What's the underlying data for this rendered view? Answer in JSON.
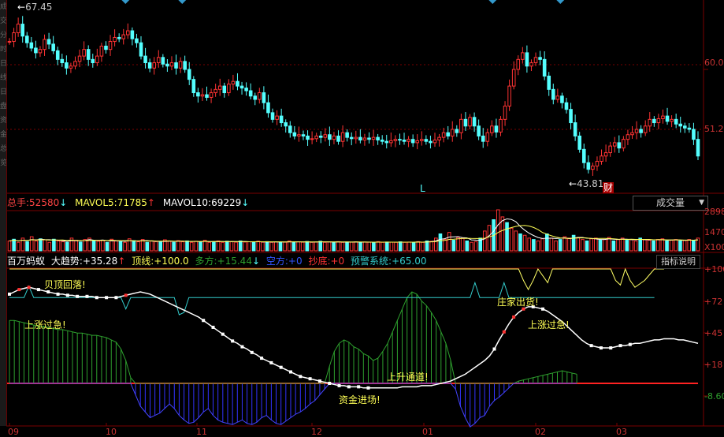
{
  "colors": {
    "up": "#ff3333",
    "down": "#54ffff",
    "grid": "#7a0000",
    "ma5": "#ffffff",
    "ma10": "#ffff55",
    "green": "#2ea02e",
    "blue": "#3333ff",
    "cyan": "#33cccc",
    "yellow": "#ffff66"
  },
  "price_panel": {
    "high_label": "67.45",
    "low_label": "43.81",
    "marker_L": "L",
    "marker_cai": "财",
    "axis": [
      "60.0",
      "51.2"
    ],
    "closes": [
      64.2,
      65.5,
      66.8,
      65.0,
      64.0,
      63.2,
      62.5,
      63.0,
      64.5,
      63.8,
      62.8,
      61.5,
      61.0,
      60.2,
      60.5,
      61.2,
      62.0,
      63.0,
      61.5,
      61.0,
      62.0,
      63.5,
      63.0,
      64.2,
      64.8,
      64.6,
      65.2,
      65.8,
      64.6,
      64.0,
      62.0,
      61.0,
      60.2,
      61.0,
      61.8,
      60.8,
      60.5,
      61.0,
      60.2,
      61.2,
      60.0,
      58.5,
      56.5,
      56.0,
      56.2,
      55.8,
      56.5,
      57.0,
      57.5,
      56.5,
      57.8,
      58.2,
      57.5,
      57.2,
      56.8,
      56.0,
      55.5,
      56.5,
      55.0,
      53.5,
      52.5,
      53.0,
      52.0,
      51.5,
      50.5,
      50.0,
      50.2,
      50.0,
      49.5,
      49.6,
      50.0,
      49.8,
      50.2,
      49.5,
      50.0,
      49.2,
      50.5,
      49.8,
      49.6,
      49.8,
      49.4,
      49.7,
      49.5,
      49.8,
      49.4,
      49.2,
      49.0,
      49.3,
      49.5,
      49.4,
      49.2,
      49.5,
      49.0,
      49.3,
      49.5,
      49.2,
      49.0,
      49.4,
      49.8,
      50.5,
      50.0,
      51.0,
      50.5,
      52.5,
      51.5,
      52.8,
      51.5,
      50.0,
      49.2,
      50.5,
      51.5,
      50.6,
      52.5,
      54.5,
      57.5,
      60.0,
      61.5,
      62.5,
      60.5,
      61.0,
      61.8,
      61.5,
      59.0,
      57.0,
      55.5,
      56.0,
      55.0,
      54.0,
      52.0,
      50.0,
      48.0,
      46.0,
      45.0,
      45.5,
      46.2,
      47.0,
      47.5,
      48.5,
      49.0,
      48.2,
      49.5,
      50.2,
      50.5,
      51.0,
      50.5,
      51.5,
      52.5,
      52.0,
      52.6,
      53.0,
      52.2,
      52.5,
      51.8,
      51.5,
      51.2,
      51.0,
      49.5,
      47.0
    ]
  },
  "volume_panel": {
    "title": "总手:",
    "total": "52580",
    "ma5_label": "MAVOL5:",
    "ma5": "71785",
    "ma10_label": "MAVOL10:",
    "ma10": "69229",
    "axis": [
      "2898",
      "1470",
      "X100"
    ],
    "dropdown": "成交量",
    "vols": [
      700,
      820,
      600,
      900,
      650,
      1000,
      700,
      850,
      780,
      600,
      820,
      700,
      650,
      600,
      900,
      750,
      620,
      800,
      900,
      700,
      680,
      750,
      600,
      820,
      700,
      650,
      600,
      850,
      720,
      640,
      800,
      600,
      700,
      650,
      620,
      780,
      690,
      600,
      720,
      640,
      700,
      600,
      680,
      620,
      750,
      600,
      640,
      700,
      600,
      680,
      650,
      610,
      700,
      620,
      640,
      600,
      680,
      610,
      650,
      600,
      640,
      620,
      610,
      700,
      600,
      640,
      610,
      660,
      600,
      620,
      680,
      600,
      640,
      610,
      650,
      600,
      620,
      610,
      640,
      600,
      620,
      610,
      600,
      650,
      600,
      620,
      610,
      600,
      640,
      600,
      620,
      610,
      650,
      600,
      700,
      680,
      900,
      1200,
      800,
      1300,
      750,
      950,
      880,
      700,
      600,
      650,
      900,
      1400,
      1800,
      2200,
      2898,
      2400,
      2000,
      1600,
      1400,
      1200,
      1100,
      900,
      800,
      700,
      850,
      1200,
      900,
      700,
      800,
      1000,
      900,
      1100,
      950,
      800,
      700,
      850,
      900,
      750,
      800,
      950,
      700,
      800,
      900,
      750,
      800,
      700,
      900,
      800,
      750,
      700,
      800,
      850,
      700,
      750,
      800,
      700,
      750,
      800,
      700,
      900
    ]
  },
  "indicator_panel": {
    "name": "百万蚂蚁",
    "trend_label": "大趋势:",
    "trend": "+35.28",
    "top_label": "顶线:",
    "top": "+100.0",
    "long_label": "多方:",
    "long": "+15.44",
    "short_label": "空方:",
    "short": "+0",
    "bottom_label": "抄底:",
    "bottom": "+0",
    "warn_label": "预警系统:",
    "warn": "+65.00",
    "button": "指标说明",
    "axis": [
      "+100",
      "+72",
      "+45",
      "+18",
      "-8.60"
    ],
    "annotations": [
      "贝顶回落!",
      "上涨过急!",
      "庄家出货!",
      "上涨过急!",
      "上升通道!",
      "资金进场!"
    ],
    "trend_vals": [
      78,
      80,
      82,
      83,
      84,
      83,
      82,
      81,
      80,
      79,
      78,
      78,
      77,
      77,
      76,
      76,
      76,
      76,
      75,
      75,
      75,
      75,
      75,
      76,
      77,
      78,
      79,
      80,
      79,
      78,
      76,
      74,
      72,
      70,
      68,
      66,
      64,
      62,
      60,
      58,
      55,
      52,
      49,
      46,
      43,
      40,
      37,
      35,
      32,
      30,
      27,
      25,
      22,
      20,
      18,
      16,
      14,
      12,
      10,
      8,
      6,
      5,
      4,
      3,
      2,
      1,
      0,
      -1,
      -2,
      -2,
      -3,
      -3,
      -3,
      -4,
      -4,
      -4,
      -4,
      -4,
      -4,
      -4,
      -4,
      -3,
      -3,
      -3,
      -3,
      -2,
      -2,
      -2,
      -1,
      0,
      1,
      2,
      4,
      6,
      8,
      11,
      14,
      17,
      20,
      24,
      30,
      38,
      45,
      52,
      58,
      62,
      65,
      67,
      67,
      66,
      65,
      63,
      60,
      57,
      54,
      50,
      46,
      42,
      38,
      35,
      33,
      32,
      31,
      31,
      31,
      32,
      33,
      33,
      34,
      35,
      35,
      36,
      37,
      38,
      38,
      39,
      39,
      39,
      38,
      38,
      37,
      36,
      35
    ],
    "green_vals": [
      55,
      55,
      54,
      53,
      52,
      51,
      50,
      50,
      49,
      48,
      47,
      47,
      46,
      45,
      44,
      44,
      43,
      42,
      42,
      41,
      40,
      38,
      36,
      30,
      20,
      5,
      -10,
      -20,
      -25,
      -30,
      -28,
      -26,
      -22,
      -18,
      -22,
      -28,
      -32,
      -35,
      -34,
      -30,
      -25,
      -22,
      -28,
      -32,
      -34,
      -35,
      -36,
      -34,
      -32,
      -35,
      -36,
      -34,
      -30,
      -28,
      -32,
      -35,
      -36,
      -33,
      -30,
      -27,
      -25,
      -22,
      -18,
      -15,
      -10,
      -5,
      15,
      28,
      35,
      38,
      36,
      32,
      30,
      26,
      24,
      20,
      22,
      28,
      35,
      45,
      55,
      65,
      75,
      80,
      78,
      72,
      68,
      62,
      55,
      45,
      35,
      20,
      -5,
      -20,
      -30,
      -38,
      -35,
      -30,
      -28,
      -20,
      -15,
      -12,
      -8,
      -4,
      0,
      2,
      3,
      4,
      5,
      6,
      7,
      8,
      9,
      10,
      11,
      10,
      9,
      8
    ],
    "cyan_vals": [
      75,
      75,
      75,
      75,
      85,
      75,
      75,
      75,
      75,
      75,
      75,
      75,
      75,
      75,
      75,
      75,
      75,
      75,
      75,
      75,
      75,
      75,
      75,
      75,
      65,
      75,
      75,
      75,
      75,
      75,
      75,
      75,
      75,
      75,
      75,
      60,
      62,
      75,
      75,
      75,
      75,
      75,
      75,
      75,
      75,
      75,
      75,
      75,
      75,
      75,
      75,
      75,
      75,
      75,
      75,
      75,
      75,
      75,
      75,
      75,
      75,
      75,
      75,
      75,
      75,
      75,
      75,
      75,
      75,
      75,
      75,
      75,
      75,
      75,
      75,
      75,
      75,
      75,
      75,
      75,
      75,
      75,
      75,
      75,
      75,
      75,
      75,
      75,
      75,
      75,
      75,
      75,
      75,
      75,
      75,
      75,
      88,
      75,
      75,
      75,
      75,
      75,
      88,
      75,
      75,
      75,
      75,
      75,
      75,
      75,
      75,
      75,
      75,
      75,
      75,
      75,
      75,
      75,
      75,
      75,
      75,
      75,
      75,
      75,
      75,
      75,
      75,
      75,
      75,
      75,
      75,
      75,
      75,
      75
    ],
    "yellow_vals": [
      100,
      100,
      100,
      100,
      100,
      100,
      100,
      100,
      100,
      100,
      100,
      100,
      100,
      100,
      100,
      100,
      100,
      100,
      100,
      100,
      100,
      100,
      100,
      100,
      100,
      100,
      100,
      100,
      100,
      100,
      100,
      100,
      100,
      100,
      100,
      100,
      100,
      100,
      100,
      100,
      100,
      100,
      100,
      100,
      100,
      100,
      100,
      100,
      100,
      100,
      100,
      100,
      100,
      100,
      100,
      100,
      100,
      100,
      100,
      100,
      100,
      100,
      100,
      100,
      100,
      100,
      100,
      100,
      100,
      100,
      100,
      100,
      100,
      100,
      100,
      100,
      100,
      100,
      100,
      100,
      100,
      100,
      100,
      100,
      100,
      100,
      100,
      100,
      100,
      100,
      100,
      100,
      100,
      100,
      100,
      100,
      100,
      100,
      100,
      100,
      100,
      100,
      100,
      100,
      100,
      100,
      90,
      82,
      90,
      100,
      94,
      88,
      100,
      100,
      100,
      100,
      100,
      100,
      100,
      100,
      100,
      100,
      100,
      100,
      100,
      90,
      86,
      100,
      90,
      84,
      87,
      90,
      95,
      100,
      100,
      100
    ]
  },
  "months": [
    "09",
    "10",
    "11",
    "12",
    "01",
    "02",
    "03"
  ]
}
